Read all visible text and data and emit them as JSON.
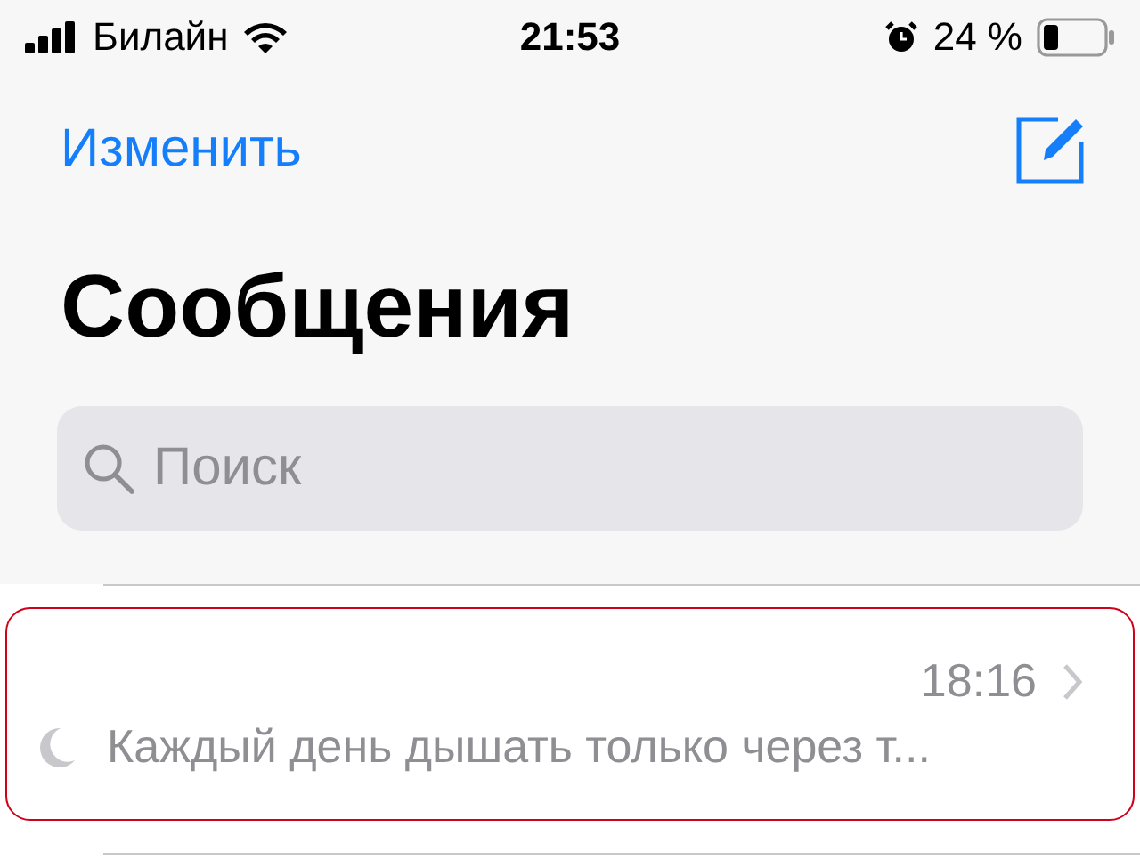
{
  "status_bar": {
    "carrier": "Билайн",
    "time": "21:53",
    "battery": "24 %"
  },
  "nav": {
    "edit": "Изменить"
  },
  "title": "Сообщения",
  "search": {
    "placeholder": "Поиск"
  },
  "messages": [
    {
      "time": "18:16",
      "preview": "Каждый день дышать только через т...",
      "muted": true,
      "selected": true
    }
  ]
}
